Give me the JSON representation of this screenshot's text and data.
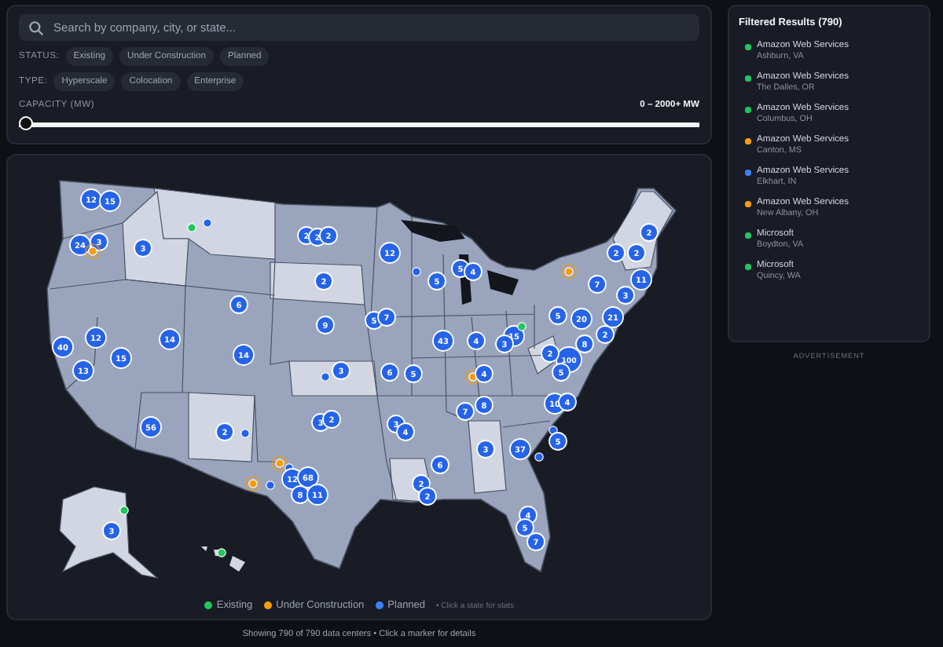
{
  "search": {
    "placeholder": "Search by company, city, or state..."
  },
  "status_filter": {
    "label": "STATUS:",
    "options": [
      "Existing",
      "Under Construction",
      "Planned"
    ]
  },
  "type_filter": {
    "label": "TYPE:",
    "options": [
      "Hyperscale",
      "Colocation",
      "Enterprise"
    ]
  },
  "capacity": {
    "label": "CAPACITY (MW)",
    "reading": "0 – 2000+ MW",
    "level": 0
  },
  "map": {
    "markers": [
      {
        "label": "12",
        "kind": "planned"
      },
      {
        "label": "15",
        "kind": "planned"
      },
      {
        "label": "24",
        "kind": "planned"
      },
      {
        "label": "3",
        "kind": "planned"
      },
      {
        "kind": "construction"
      },
      {
        "label": "3",
        "kind": "planned"
      },
      {
        "kind": "existing"
      },
      {
        "kind": "planned"
      },
      {
        "label": "2",
        "kind": "planned"
      },
      {
        "label": "2",
        "kind": "planned"
      },
      {
        "label": "2",
        "kind": "planned"
      },
      {
        "label": "2",
        "kind": "planned"
      },
      {
        "label": "6",
        "kind": "planned"
      },
      {
        "label": "9",
        "kind": "planned"
      },
      {
        "label": "40",
        "kind": "planned"
      },
      {
        "label": "12",
        "kind": "planned"
      },
      {
        "label": "15",
        "kind": "planned"
      },
      {
        "label": "14",
        "kind": "planned"
      },
      {
        "label": "14",
        "kind": "planned"
      },
      {
        "label": "13",
        "kind": "planned"
      },
      {
        "label": "12",
        "kind": "planned"
      },
      {
        "kind": "planned"
      },
      {
        "label": "5",
        "kind": "planned"
      },
      {
        "label": "5",
        "kind": "planned"
      },
      {
        "label": "4",
        "kind": "planned"
      },
      {
        "kind": "construction"
      },
      {
        "label": "7",
        "kind": "planned"
      },
      {
        "label": "2",
        "kind": "planned"
      },
      {
        "label": "2",
        "kind": "planned"
      },
      {
        "label": "2",
        "kind": "planned"
      },
      {
        "label": "11",
        "kind": "planned"
      },
      {
        "label": "3",
        "kind": "planned"
      },
      {
        "label": "5",
        "kind": "planned"
      },
      {
        "label": "7",
        "kind": "planned"
      },
      {
        "label": "43",
        "kind": "planned"
      },
      {
        "label": "4",
        "kind": "planned"
      },
      {
        "label": "15",
        "kind": "planned"
      },
      {
        "label": "3",
        "kind": "planned"
      },
      {
        "kind": "existing"
      },
      {
        "label": "5",
        "kind": "planned"
      },
      {
        "label": "20",
        "kind": "planned"
      },
      {
        "label": "21",
        "kind": "planned"
      },
      {
        "label": "2",
        "kind": "planned"
      },
      {
        "label": "8",
        "kind": "planned"
      },
      {
        "label": "100",
        "kind": "planned"
      },
      {
        "label": "2",
        "kind": "planned"
      },
      {
        "label": "3",
        "kind": "planned"
      },
      {
        "kind": "planned"
      },
      {
        "label": "6",
        "kind": "planned"
      },
      {
        "label": "5",
        "kind": "planned"
      },
      {
        "kind": "construction"
      },
      {
        "label": "4",
        "kind": "planned"
      },
      {
        "label": "5",
        "kind": "planned"
      },
      {
        "label": "10",
        "kind": "planned"
      },
      {
        "label": "4",
        "kind": "planned"
      },
      {
        "label": "7",
        "kind": "planned"
      },
      {
        "label": "8",
        "kind": "planned"
      },
      {
        "label": "56",
        "kind": "planned"
      },
      {
        "label": "2",
        "kind": "planned"
      },
      {
        "kind": "planned"
      },
      {
        "label": "3",
        "kind": "planned"
      },
      {
        "label": "2",
        "kind": "planned"
      },
      {
        "label": "3",
        "kind": "planned"
      },
      {
        "label": "4",
        "kind": "planned"
      },
      {
        "kind": "planned"
      },
      {
        "label": "5",
        "kind": "planned"
      },
      {
        "label": "37",
        "kind": "planned"
      },
      {
        "kind": "planned"
      },
      {
        "label": "3",
        "kind": "planned"
      },
      {
        "label": "6",
        "kind": "planned"
      },
      {
        "kind": "construction"
      },
      {
        "kind": "planned"
      },
      {
        "label": "12",
        "kind": "planned"
      },
      {
        "label": "68",
        "kind": "planned"
      },
      {
        "label": "8",
        "kind": "planned"
      },
      {
        "label": "11",
        "kind": "planned"
      },
      {
        "kind": "construction"
      },
      {
        "kind": "planned"
      },
      {
        "label": "2",
        "kind": "planned"
      },
      {
        "label": "2",
        "kind": "planned"
      },
      {
        "label": "4",
        "kind": "planned"
      },
      {
        "label": "5",
        "kind": "planned"
      },
      {
        "label": "7",
        "kind": "planned"
      },
      {
        "kind": "existing"
      },
      {
        "label": "3",
        "kind": "planned"
      },
      {
        "kind": "existing"
      }
    ]
  },
  "legend": [
    {
      "label": "Existing",
      "color": "#22c55e"
    },
    {
      "label": "Under Construction",
      "color": "#f59e0b"
    },
    {
      "label": "Planned",
      "color": "#3b82f6"
    }
  ],
  "legend_hint": "• Click a state for stats",
  "results": {
    "title": "Filtered Results (790)",
    "items": [
      {
        "company": "Amazon Web Services",
        "location": "Ashburn, VA",
        "color": "#22c55e"
      },
      {
        "company": "Amazon Web Services",
        "location": "The Dalles, OR",
        "color": "#22c55e"
      },
      {
        "company": "Amazon Web Services",
        "location": "Columbus, OH",
        "color": "#22c55e"
      },
      {
        "company": "Amazon Web Services",
        "location": "Canton, MS",
        "color": "#f59e0b"
      },
      {
        "company": "Amazon Web Services",
        "location": "Elkhart, IN",
        "color": "#3b82f6"
      },
      {
        "company": "Amazon Web Services",
        "location": "New Albany, OH",
        "color": "#f59e0b"
      },
      {
        "company": "Microsoft",
        "location": "Boydton, VA",
        "color": "#22c55e"
      },
      {
        "company": "Microsoft",
        "location": "Quincy, WA",
        "color": "#22c55e"
      }
    ]
  },
  "advertisement": "ADVERTISEMENT",
  "footer": "Showing 790 of 790 data centers • Click a marker for details"
}
